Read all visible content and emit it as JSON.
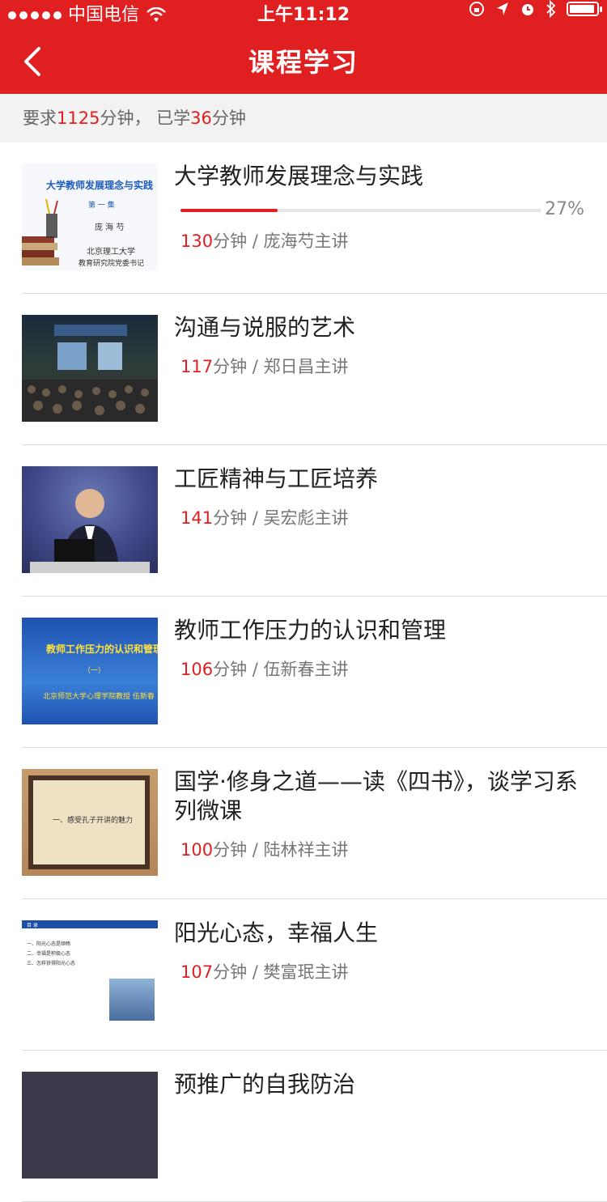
{
  "status_bar": {
    "carrier": "中国电信",
    "time": "上午11:12"
  },
  "nav": {
    "title": "课程学习"
  },
  "summary": {
    "required_prefix": "要求",
    "required_value": "1125",
    "required_unit": "分钟，",
    "learned_prefix": "已学",
    "learned_value": "36",
    "learned_unit": "分钟"
  },
  "courses": [
    {
      "title": "大学教师发展理念与实践",
      "minutes": "130",
      "unit": "分钟",
      "sep": " / ",
      "lecturer": "庞海芍主讲",
      "progress_label": "27%",
      "progress": 0.27,
      "thumb": {
        "heading": "大学教师发展理念与实践",
        "episode": "第 一 集",
        "name": "庞 海 芍",
        "org1": "北京理工大学",
        "org2": "教育研究院党委书记"
      }
    },
    {
      "title": "沟通与说服的艺术",
      "minutes": "117",
      "unit": "分钟",
      "sep": " / ",
      "lecturer": "郑日昌主讲"
    },
    {
      "title": "工匠精神与工匠培养",
      "minutes": "141",
      "unit": "分钟",
      "sep": " / ",
      "lecturer": "吴宏彪主讲"
    },
    {
      "title": "教师工作压力的认识和管理",
      "minutes": "106",
      "unit": "分钟",
      "sep": " / ",
      "lecturer": "伍新春主讲",
      "thumb": {
        "heading": "教师工作压力的认识和管理",
        "mark": "（一）",
        "footer": "北京师范大学心理学院教授    伍新春"
      }
    },
    {
      "title": "国学·修身之道——读《四书》，谈学习系列微课",
      "minutes": "100",
      "unit": "分钟",
      "sep": " / ",
      "lecturer": "陆林祥主讲",
      "thumb": {
        "text": "一、感受孔子开讲的魅力"
      }
    },
    {
      "title": "阳光心态，幸福人生",
      "minutes": "107",
      "unit": "分钟",
      "sep": " / ",
      "lecturer": "樊富珉主讲",
      "thumb": {
        "header": "目 录",
        "line1": "一、阳光心态是顺畅",
        "line2": "二、幸福是积极心态",
        "line3": "三、怎样获得阳光心态"
      }
    },
    {
      "title": "预推广的自我防治"
    }
  ]
}
